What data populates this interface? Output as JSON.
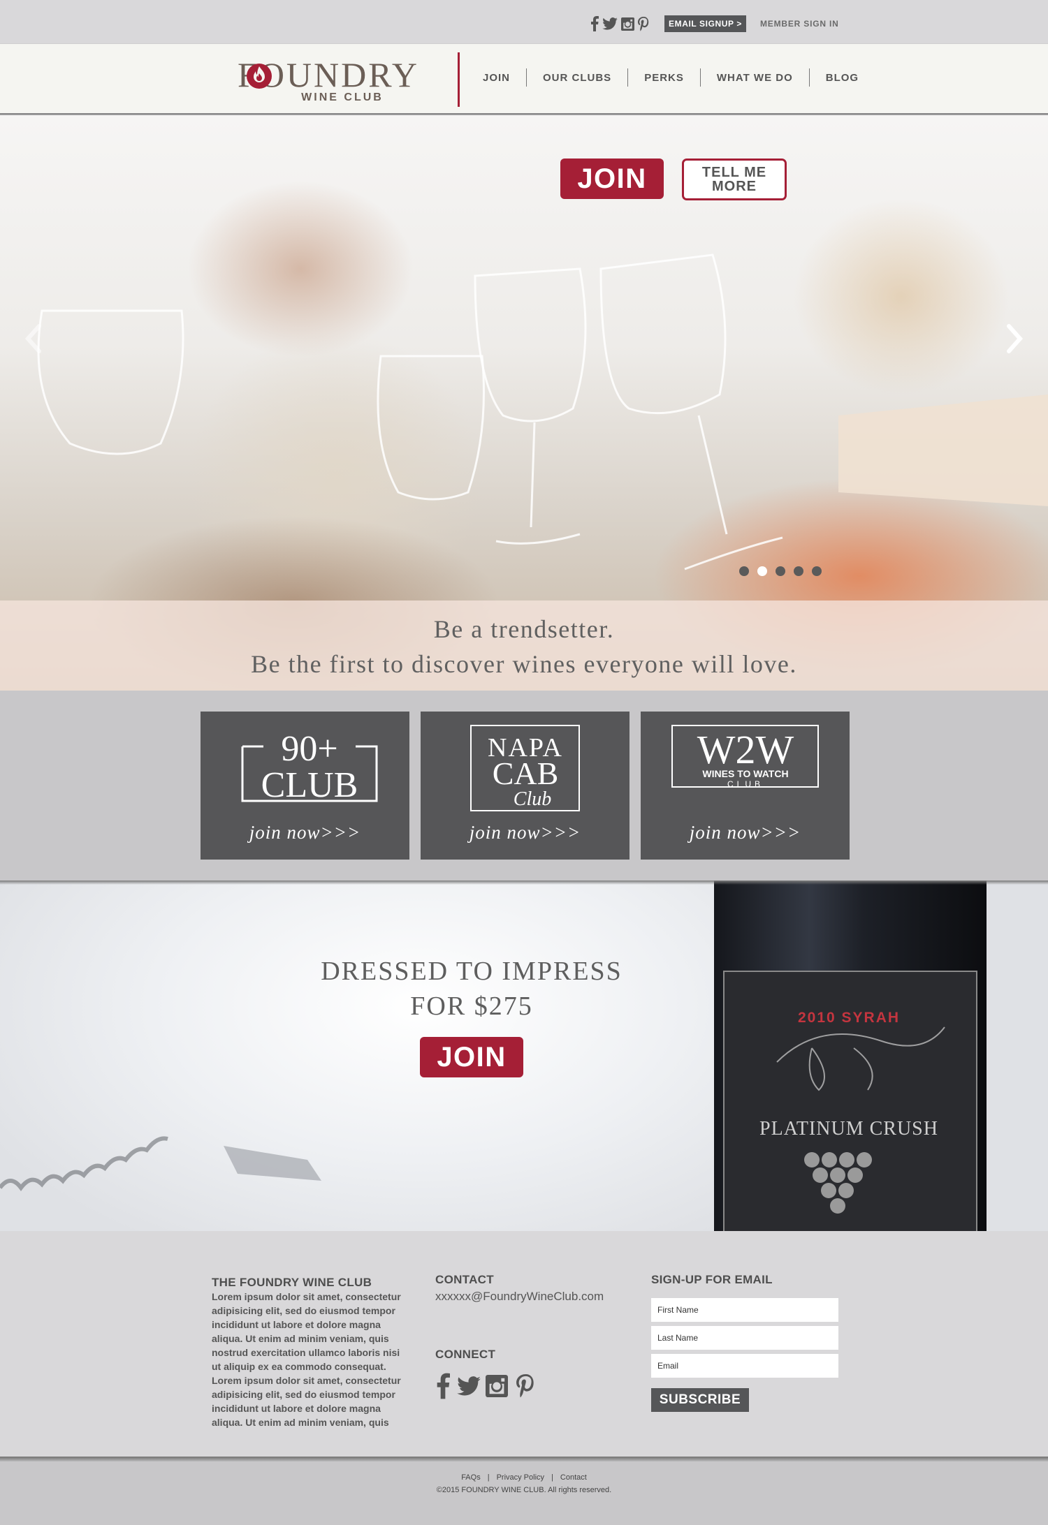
{
  "top_bar": {
    "social": [
      "facebook-icon",
      "twitter-icon",
      "instagram-icon",
      "pinterest-icon"
    ],
    "email_signup": "EMAIL SIGNUP >",
    "member_signin": "MEMBER SIGN IN"
  },
  "header": {
    "logo_word": "FOUNDRY",
    "logo_sub": "WINE CLUB",
    "nav": [
      "JOIN",
      "OUR CLUBS",
      "PERKS",
      "WHAT WE DO",
      "BLOG"
    ]
  },
  "hero": {
    "join_label": "JOIN",
    "more_line1": "TELL ME",
    "more_line2": "MORE",
    "slide_count": 5,
    "active_slide": 2,
    "tagline_line1": "Be a trendsetter.",
    "tagline_line2": "Be the first to discover wines everyone will love."
  },
  "clubs": [
    {
      "logo_top": "90+",
      "logo_bottom": "CLUB",
      "cta": "join now>>>"
    },
    {
      "logo_top": "NAPA",
      "logo_mid": "CAB",
      "logo_script": "Club",
      "cta": "join now>>>"
    },
    {
      "logo_top": "W2W",
      "logo_mid": "WINES TO WATCH",
      "logo_bottom": "CLUB",
      "cta": "join now>>>"
    }
  ],
  "promo": {
    "line1": "DRESSED TO IMPRESS",
    "line2": "FOR $275",
    "join_label": "JOIN",
    "bottle_vintage": "2010 SYRAH",
    "bottle_name": "PLATINUM CRUSH"
  },
  "footer": {
    "about_heading": "THE FOUNDRY WINE CLUB",
    "about_text": "Lorem ipsum dolor sit amet, consectetur adipisicing elit, sed do eiusmod tempor incididunt ut labore et dolore magna aliqua. Ut enim ad minim veniam, quis nostrud exercitation ullamco laboris nisi ut aliquip ex ea commodo consequat. Lorem ipsum dolor sit amet, consectetur adipisicing elit, sed do eiusmod tempor incididunt ut labore et dolore magna aliqua. Ut enim ad minim veniam, quis",
    "contact_heading": "CONTACT",
    "contact_email": "xxxxxx@FoundryWineClub.com",
    "connect_heading": "CONNECT",
    "connect_social": [
      "facebook-icon",
      "twitter-icon",
      "instagram-icon",
      "pinterest-icon"
    ],
    "signup_heading": "SIGN-UP FOR EMAIL",
    "first_name_placeholder": "First Name",
    "last_name_placeholder": "Last Name",
    "email_placeholder": "Email",
    "subscribe_label": "SUBSCRIBE"
  },
  "bottom": {
    "links": [
      "FAQs",
      "Privacy Policy",
      "Contact"
    ],
    "copyright": "©2015 FOUNDRY WINE CLUB.  All rights reserved."
  },
  "colors": {
    "accent": "#a51f36",
    "dark_gray": "#555658",
    "light_gray": "#d9d8da"
  }
}
